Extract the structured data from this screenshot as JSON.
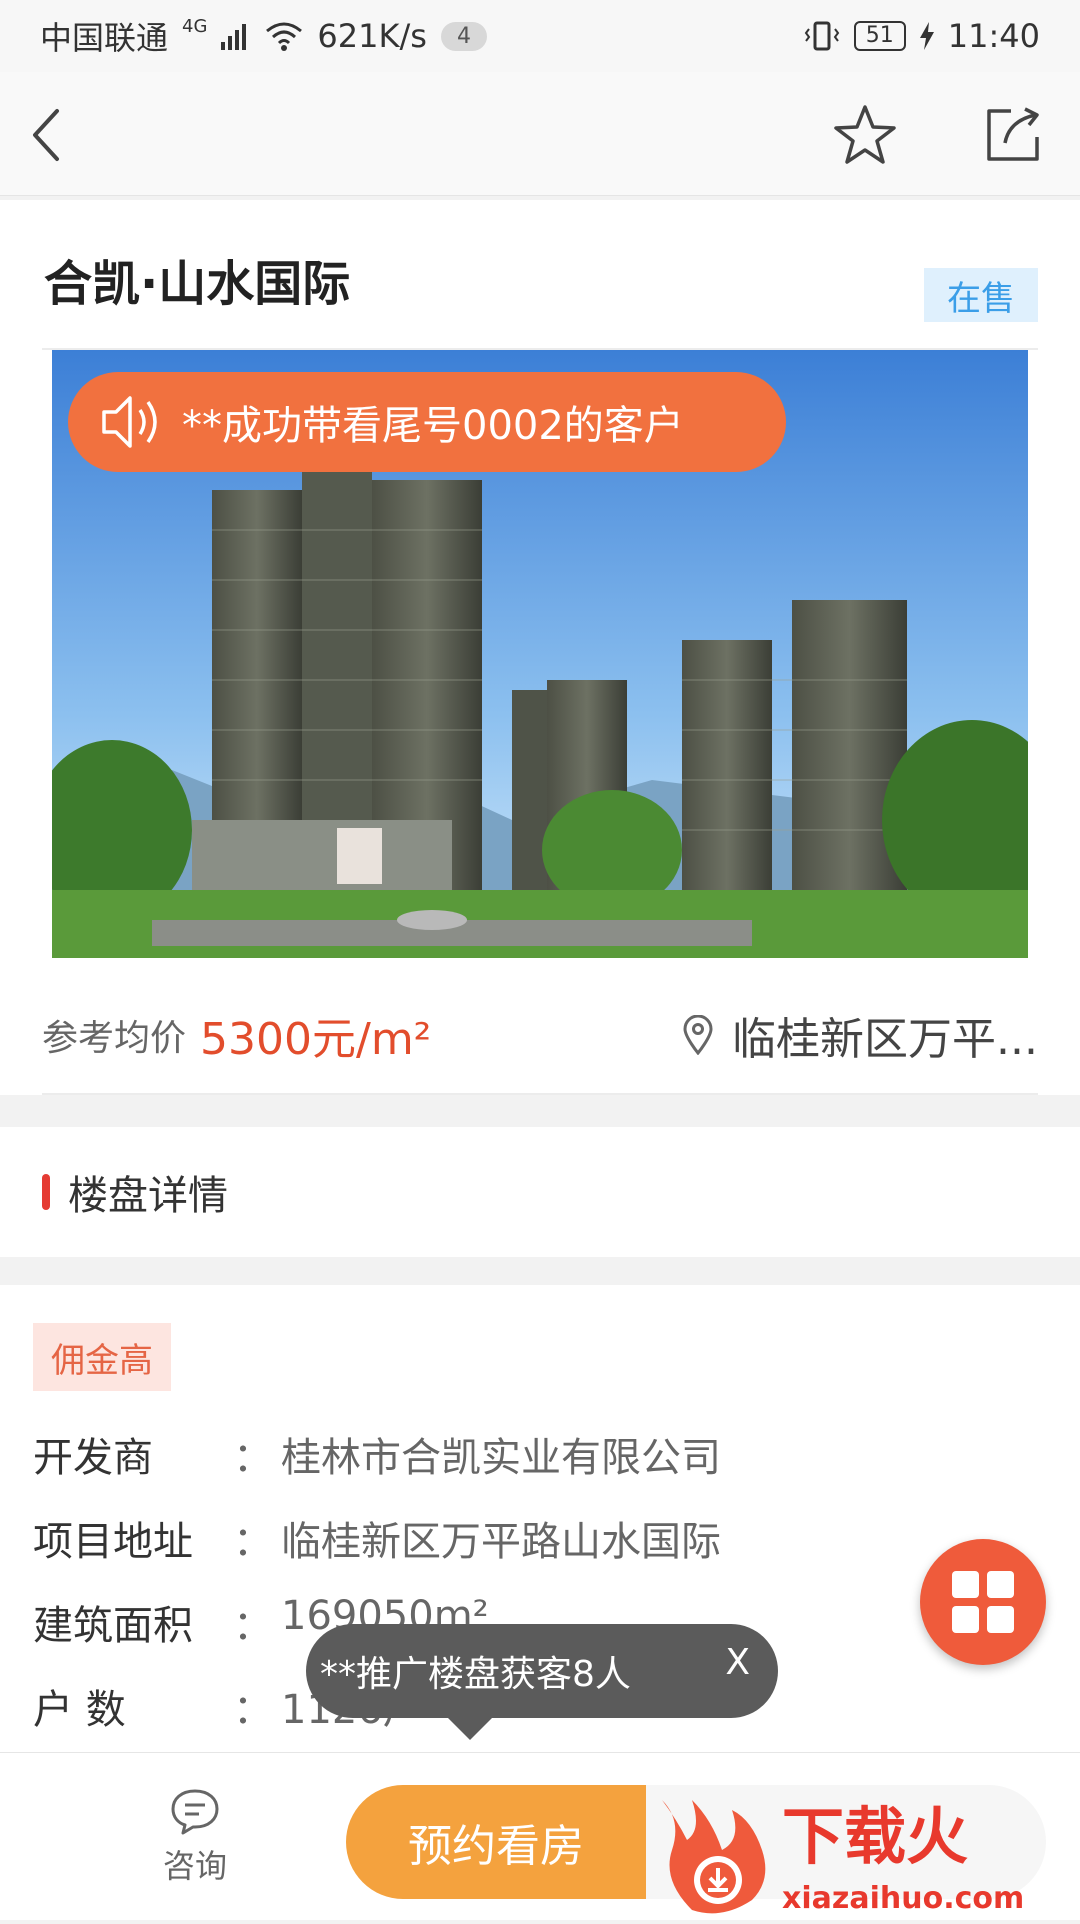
{
  "status_bar": {
    "carrier": "中国联通",
    "network": "4G",
    "speed": "621K/s",
    "notification_count": "4",
    "battery": "51",
    "time": "11:40"
  },
  "header": {
    "back_icon": "chevron-left-icon",
    "favorite_icon": "star-outline-icon",
    "share_icon": "share-icon"
  },
  "project": {
    "title": "合凯·山水国际",
    "status": "在售",
    "toast": "**成功带看尾号0002的客户",
    "price_label": "参考均价",
    "price_value": "5300元/m²",
    "location": "临桂新区万平..."
  },
  "section": {
    "title": "楼盘详情"
  },
  "details": {
    "tag": "佣金高",
    "colon": "：",
    "rows": [
      {
        "label": "开发商",
        "value": "桂林市合凯实业有限公司"
      },
      {
        "label": "项目地址",
        "value": "临桂新区万平路山水国际"
      },
      {
        "label": "建筑面积",
        "value": "169050m²"
      },
      {
        "label": "户 数",
        "value": "1126户"
      }
    ]
  },
  "tooltip": {
    "text": "**推广楼盘获客8人",
    "close": "X"
  },
  "bottom_bar": {
    "consult_label": "咨询",
    "book_label": "预约看房"
  },
  "watermark": {
    "brand": "下载火",
    "url": "xiazaihuo.com"
  },
  "colors": {
    "accent": "#f1713f",
    "price": "#e24d2c",
    "sale_tag": "#3b9ee8",
    "book_button": "#f4a23e"
  }
}
